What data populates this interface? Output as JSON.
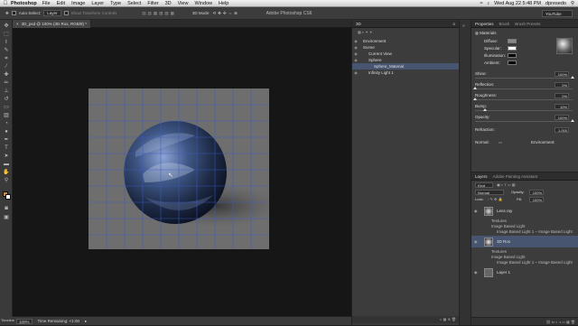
{
  "menubar": {
    "app": "Photoshop",
    "items": [
      "File",
      "Edit",
      "Image",
      "Layer",
      "Type",
      "Select",
      "Filter",
      "3D",
      "View",
      "Window",
      "Help"
    ],
    "clock": "Wed Aug 22  5:48 PM",
    "user": "dpresedo"
  },
  "window_title": "Adobe Photoshop CS6",
  "options": {
    "auto_select_label": "Auto-Select:",
    "auto_select_value": "Layer",
    "show_transform": "Show Transform Controls",
    "mode_3d": "3D Mode:",
    "workspace": "YouTube"
  },
  "document": {
    "tab_title": "3D_psd @ 100% (3D Ros, RGB/8) *",
    "zoom": "100%",
    "status_info": "Time Remaining: <1:00",
    "timeline": "Timeline"
  },
  "panel3d": {
    "title": "3D",
    "items": [
      {
        "label": "Environment",
        "indent": 1
      },
      {
        "label": "Scene",
        "indent": 1
      },
      {
        "label": "Current View",
        "indent": 2
      },
      {
        "label": "Sphere",
        "indent": 2
      },
      {
        "label": "Sphere_Material",
        "indent": 3,
        "selected": true
      },
      {
        "label": "Infinity Light 1",
        "indent": 2
      }
    ]
  },
  "properties": {
    "tabs": [
      "Properties",
      "Brush",
      "Brush Presets"
    ],
    "section": "Materials",
    "rows": [
      {
        "label": "Diffuse:"
      },
      {
        "label": "Specular:"
      },
      {
        "label": "Illumination:"
      },
      {
        "label": "Ambient:"
      }
    ],
    "sliders": [
      {
        "label": "Shine:",
        "value": "100%",
        "pos": 1.0
      },
      {
        "label": "Reflection:",
        "value": "0%",
        "pos": 0.0
      },
      {
        "label": "Roughness:",
        "value": "0%",
        "pos": 0.0
      },
      {
        "label": "Bump:",
        "value": "10%",
        "pos": 0.1
      },
      {
        "label": "Opacity:",
        "value": "100%",
        "pos": 1.0
      },
      {
        "label": "Refraction:",
        "value": "1.000",
        "pos": 0.0
      }
    ],
    "normal": "Normal:",
    "environment": "Environment:"
  },
  "layers": {
    "tabs": [
      "Layers",
      "Adobe Painting Assistant"
    ],
    "kind": "Kind",
    "blend_mode": "Normal",
    "opacity_label": "Opacity:",
    "opacity": "100%",
    "lock_label": "Lock:",
    "fill_label": "Fill:",
    "fill": "100%",
    "list": [
      {
        "label": "Lens ray",
        "kind": "layer"
      },
      {
        "label": "Textures",
        "kind": "sub"
      },
      {
        "label": "Image Based Light",
        "kind": "sub"
      },
      {
        "label": "Image Based Light 1 – Image Based Light",
        "kind": "subsub"
      },
      {
        "label": "3D Ros",
        "kind": "layer",
        "selected": true
      },
      {
        "label": "Textures",
        "kind": "sub"
      },
      {
        "label": "Image Based Light",
        "kind": "sub"
      },
      {
        "label": "Image Based Light 1 – Image Based Light",
        "kind": "subsub"
      },
      {
        "label": "Layer 1",
        "kind": "layer"
      }
    ]
  },
  "colors": {
    "accent": "#485570",
    "canvas_bg": "#161616",
    "artboard": "#6e6e6e",
    "grid": "#3c5cc8"
  }
}
